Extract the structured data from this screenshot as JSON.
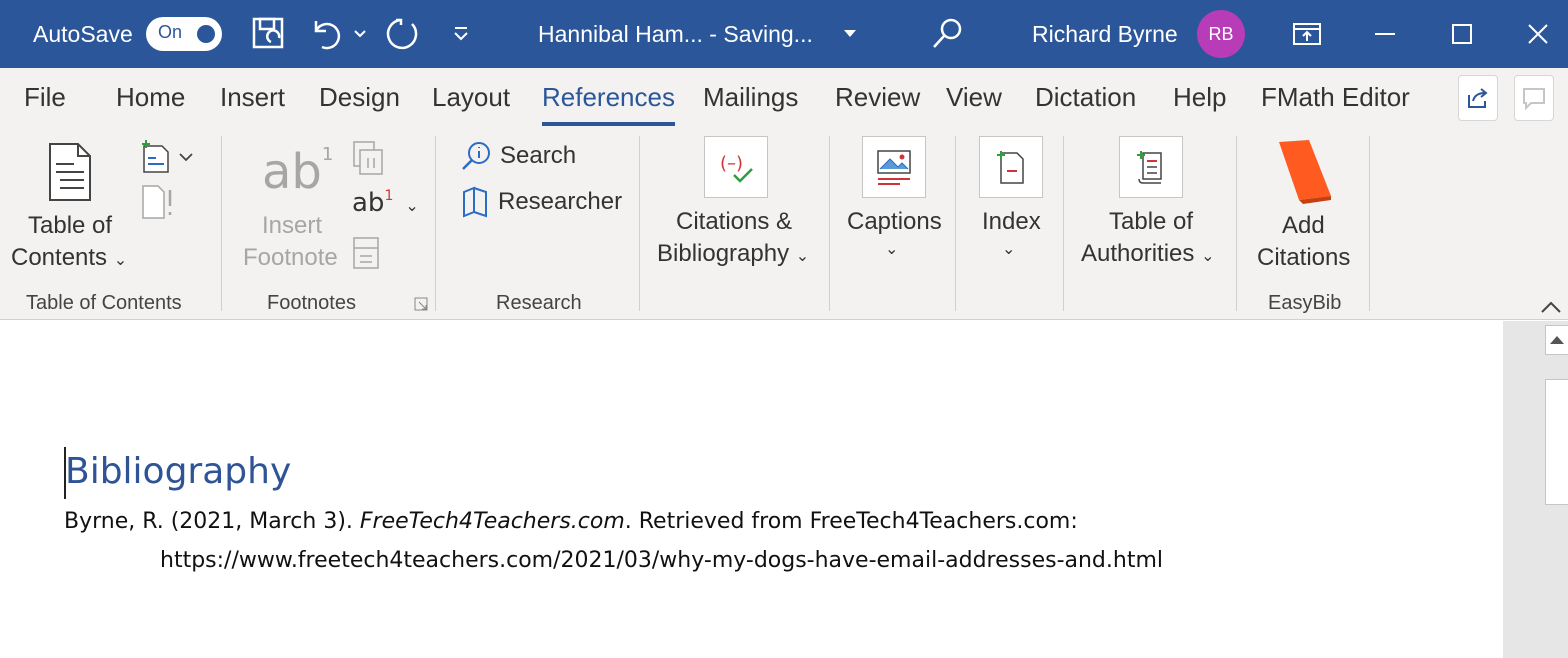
{
  "titlebar": {
    "autosave_label": "AutoSave",
    "autosave_state": "On",
    "doc_title": "Hannibal Ham...  -  Saving...",
    "user_name": "Richard Byrne",
    "user_initials": "RB"
  },
  "tabs": [
    "File",
    "Home",
    "Insert",
    "Design",
    "Layout",
    "References",
    "Mailings",
    "Review",
    "View",
    "Dictation",
    "Help",
    "FMath Editor"
  ],
  "active_tab": "References",
  "ribbon": {
    "toc": {
      "line1": "Table of",
      "line2": "Contents",
      "group": "Table of Contents"
    },
    "footnotes": {
      "line1": "Insert",
      "line2": "Footnote",
      "group": "Footnotes",
      "icon_text": "ab",
      "icon_sup": "1"
    },
    "research": {
      "search": "Search",
      "researcher": "Researcher",
      "group": "Research"
    },
    "citations": {
      "line1": "Citations &",
      "line2": "Bibliography"
    },
    "captions": {
      "label": "Captions"
    },
    "index": {
      "label": "Index"
    },
    "authorities": {
      "line1": "Table of",
      "line2": "Authorities"
    },
    "easybib": {
      "line1": "Add",
      "line2": "Citations",
      "group": "EasyBib"
    }
  },
  "document": {
    "heading": "Bibliography",
    "entry_prefix": "Byrne, R. (2021, March 3). ",
    "entry_title": "FreeTech4Teachers.com",
    "entry_suffix": ". Retrieved from FreeTech4Teachers.com:",
    "entry_url": "https://www.freetech4teachers.com/2021/03/why-my-dogs-have-email-addresses-and.html"
  },
  "colors": {
    "title_bar": "#2b579a",
    "avatar": "#b83bb7",
    "heading": "#2f5496",
    "easybib_book": "#ff5a1f"
  }
}
